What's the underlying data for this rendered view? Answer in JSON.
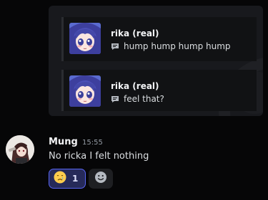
{
  "embed": {
    "quotes": [
      {
        "author": "rika (real)",
        "text": "hump hump hump hump"
      },
      {
        "author": "rika (real)",
        "text": "feel that?"
      }
    ]
  },
  "message": {
    "author": "Mung",
    "timestamp": "15:55",
    "text": "No ricka I felt nothing",
    "reaction": {
      "emoji": "crying-face",
      "count": "1"
    }
  },
  "colors": {
    "background": "#060607",
    "embed_bg": "#18191d",
    "reaction_border": "#5865f2",
    "reaction_bg": "#262a59"
  }
}
